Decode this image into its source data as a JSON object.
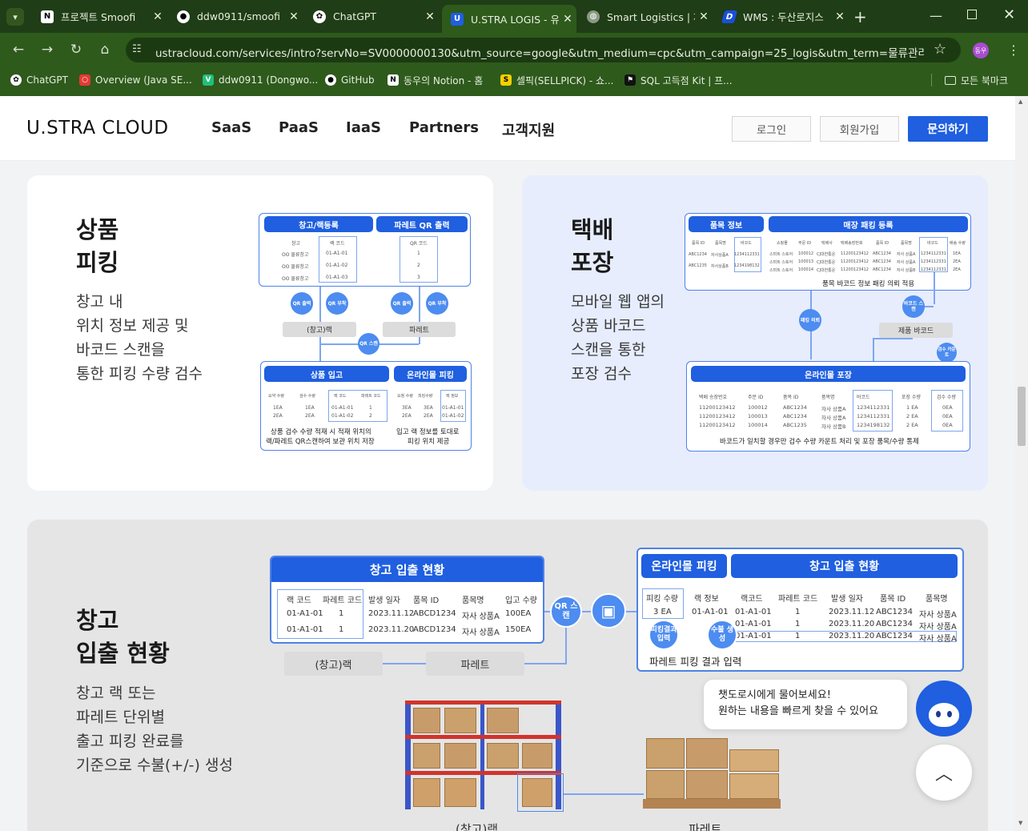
{
  "browser": {
    "tabs": [
      {
        "title": "프로젝트 Smoofi",
        "icon": "notion-icon"
      },
      {
        "title": "ddw0911/smoofi",
        "icon": "github-icon"
      },
      {
        "title": "ChatGPT",
        "icon": "chatgpt-icon"
      },
      {
        "title": "U.STRA LOGIS - 유",
        "icon": "ustra-icon"
      },
      {
        "title": "Smart Logistics | 제",
        "icon": "globe-icon"
      },
      {
        "title": "WMS : 두산로지스",
        "icon": "wms-icon"
      }
    ],
    "url": "ustracloud.com/services/intro?servNo=SV0000000130&utm_source=google&utm_medium=cpc&utm_campaign=25_logis&utm_term=물류관리시스...",
    "profile": "동우",
    "bookmarks": [
      "ChatGPT",
      "Overview (Java SE...",
      "ddw0911 (Dongwo...",
      "GitHub",
      "동우의 Notion - 홈",
      "셀픽(SELLPICK) - 쇼...",
      "SQL 고득점 Kit | 프..."
    ],
    "all_bookmarks": "모든 북마크"
  },
  "site": {
    "logo": "U.STRA CLOUD",
    "nav": [
      "SaaS",
      "PaaS",
      "IaaS",
      "Partners",
      "고객지원"
    ],
    "login": "로그인",
    "signup": "회원가입",
    "inquiry": "문의하기",
    "chat_bubble": [
      "챗도로시에게 물어보세요!",
      "원하는 내용을 빠르게 찾을 수 있어요"
    ]
  },
  "section1": {
    "title": [
      "상품",
      "피킹"
    ],
    "desc": [
      "창고 내",
      "위치 정보 제공 및",
      "바코드 스캔을",
      "통한 피킹 수량 검수"
    ],
    "d": {
      "rack_reg": "창고/랙등록",
      "pallet_qr": "파레트 QR 출력",
      "rack_cols": [
        "창고",
        "랙 코드"
      ],
      "rack_rows": [
        [
          "OO 물류창고",
          "01-A1-01"
        ],
        [
          "OO 물류창고",
          "01-A1-02"
        ],
        [
          "OO 물류창고",
          "01-A1-03"
        ]
      ],
      "qr_col": "QR 코드",
      "qr_rows": [
        "1",
        "2",
        "3"
      ],
      "c_qr_print": "QR 출력",
      "c_qr_attach": "QR 부착",
      "bar_rack": "(창고)랙",
      "bar_pallet": "파레트",
      "c_qr_scan": "QR 스캔",
      "in_head": "상품 입고",
      "pick_head": "온라인몰 피킹",
      "in_cols": [
        "요약 수량",
        "검수 수량",
        "랙 코드",
        "파레트 코드"
      ],
      "in_rows": [
        [
          "1EA",
          "1EA",
          "01-A1-01",
          "1"
        ],
        [
          "2EA",
          "2EA",
          "01-A1-02",
          "2"
        ]
      ],
      "pick_cols": [
        "요청 수량",
        "피킹수량",
        "랙 정보"
      ],
      "pick_rows": [
        [
          "3EA",
          "3EA",
          "01-A1-01"
        ],
        [
          "2EA",
          "2EA",
          "01-A1-02"
        ]
      ],
      "note_left": [
        "상품 검수 수량 적재 시 적재 위치의",
        "랙/파레트 QR스캔하여 보관 위치 저장"
      ],
      "note_right": [
        "입고 랙 정보를 토대로",
        "피킹 위치 제공"
      ]
    }
  },
  "section2": {
    "title": [
      "택배",
      "포장"
    ],
    "desc": [
      "모바일 웹 앱의",
      "상품 바코드",
      "스캔을 통한",
      "포장 검수"
    ],
    "d": {
      "item_head": "품목 정보",
      "pack_head": "매장 패킹 등록",
      "item_cols": [
        "품목 ID",
        "품목명",
        "바코드"
      ],
      "item_rows": [
        [
          "ABC1234",
          "자사상품A",
          "1234112331"
        ],
        [
          "ABC1235",
          "자사상품B",
          "1234198132"
        ]
      ],
      "pack_cols": [
        "쇼핑몰",
        "주문 ID",
        "택배사",
        "택배송장번호",
        "품목 ID",
        "품목명",
        "바코드",
        "배송 수량"
      ],
      "pack_rows": [
        [
          "스마트 스토어",
          "100012",
          "CJ대한통운",
          "11200123412",
          "ABC1234",
          "자사 상품A",
          "1234112331",
          "1EA"
        ],
        [
          "스마트 스토어",
          "100013",
          "CJ대한통운",
          "11200123412",
          "ABC1234",
          "자사 상품A",
          "1234112331",
          "2EA"
        ],
        [
          "스마트 스토어",
          "100014",
          "CJ대한통운",
          "11200123412",
          "ABC1234",
          "자사 상품B",
          "1234112331",
          "2EA"
        ]
      ],
      "pack_note": "품목 바코드 정보 패킹 의뢰 적용",
      "c_pack_req": "패킹 의뢰",
      "c_barcode_scan": "바코드 스캔",
      "bar_barcode": "제품 바코드",
      "c_inspect": "검수 카운트",
      "online_head": "온라인몰 포장",
      "online_cols": [
        "택배 송장번호",
        "주문 ID",
        "품목 ID",
        "품목명",
        "바코드",
        "포장 수량",
        "검수 수량"
      ],
      "online_rows": [
        [
          "11200123412",
          "100012",
          "ABC1234",
          "자사 상품A",
          "1234112331",
          "1 EA",
          "0EA"
        ],
        [
          "11200123412",
          "100013",
          "ABC1234",
          "자사 상품A",
          "1234112331",
          "2 EA",
          "0EA"
        ],
        [
          "11200123412",
          "100014",
          "ABC1235",
          "자사 상품B",
          "1234198132",
          "2 EA",
          "0EA"
        ]
      ],
      "online_note": "바코드가 일치할 경우만 검수 수량 카운트 처리 및 포장 품목/수량 통제"
    }
  },
  "section3": {
    "title": [
      "창고",
      "입출 현황"
    ],
    "desc": [
      "창고 랙 또는",
      "파레트 단위별",
      "출고 피킹 완료를",
      "기준으로 수불(+/-) 생성"
    ],
    "d": {
      "status_head": "창고 입출 현황",
      "s_cols": [
        "랙 코드",
        "파레트 코드",
        "발생 일자",
        "품목 ID",
        "품목명",
        "입고 수량"
      ],
      "s_rows": [
        [
          "01-A1-01",
          "1",
          "2023.11.12",
          "ABCD1234",
          "자사 상품A",
          "100EA"
        ],
        [
          "01-A1-01",
          "1",
          "2023.11.20",
          "ABCD1234",
          "자사 상품A",
          "150EA"
        ]
      ],
      "c_qr_scan": "QR 스캔",
      "bar_rack": "(창고)랙",
      "bar_pallet": "파레트",
      "pick_head": "온라인몰 피킹",
      "status_head2": "창고 입출 현황",
      "pick_cols": [
        "피킹 수량",
        "랙 정보"
      ],
      "pick_vals": [
        "3 EA",
        "01-A1-01"
      ],
      "r_cols": [
        "랙코드",
        "파레트 코드",
        "발생 일자",
        "품목 ID",
        "품목명"
      ],
      "r_rows": [
        [
          "01-A1-01",
          "1",
          "2023.11.12",
          "ABC1234",
          "자사 상품A"
        ],
        [
          "01-A1-01",
          "1",
          "2023.11.20",
          "ABC1234",
          "자사 상품A"
        ],
        [
          "01-A1-01",
          "1",
          "2023.11.20",
          "ABC1234",
          "자사 상품A"
        ]
      ],
      "c_pick_input": "피킹결과 입력",
      "c_auto": "수불 생성",
      "pick_note": "파레트 피킹 결과 입력",
      "img_rack": "(창고)랙",
      "img_pallet": "파레트"
    }
  },
  "colors": {
    "brand_blue": "#1f5fe0",
    "chrome_green": "#2e5a1c"
  }
}
